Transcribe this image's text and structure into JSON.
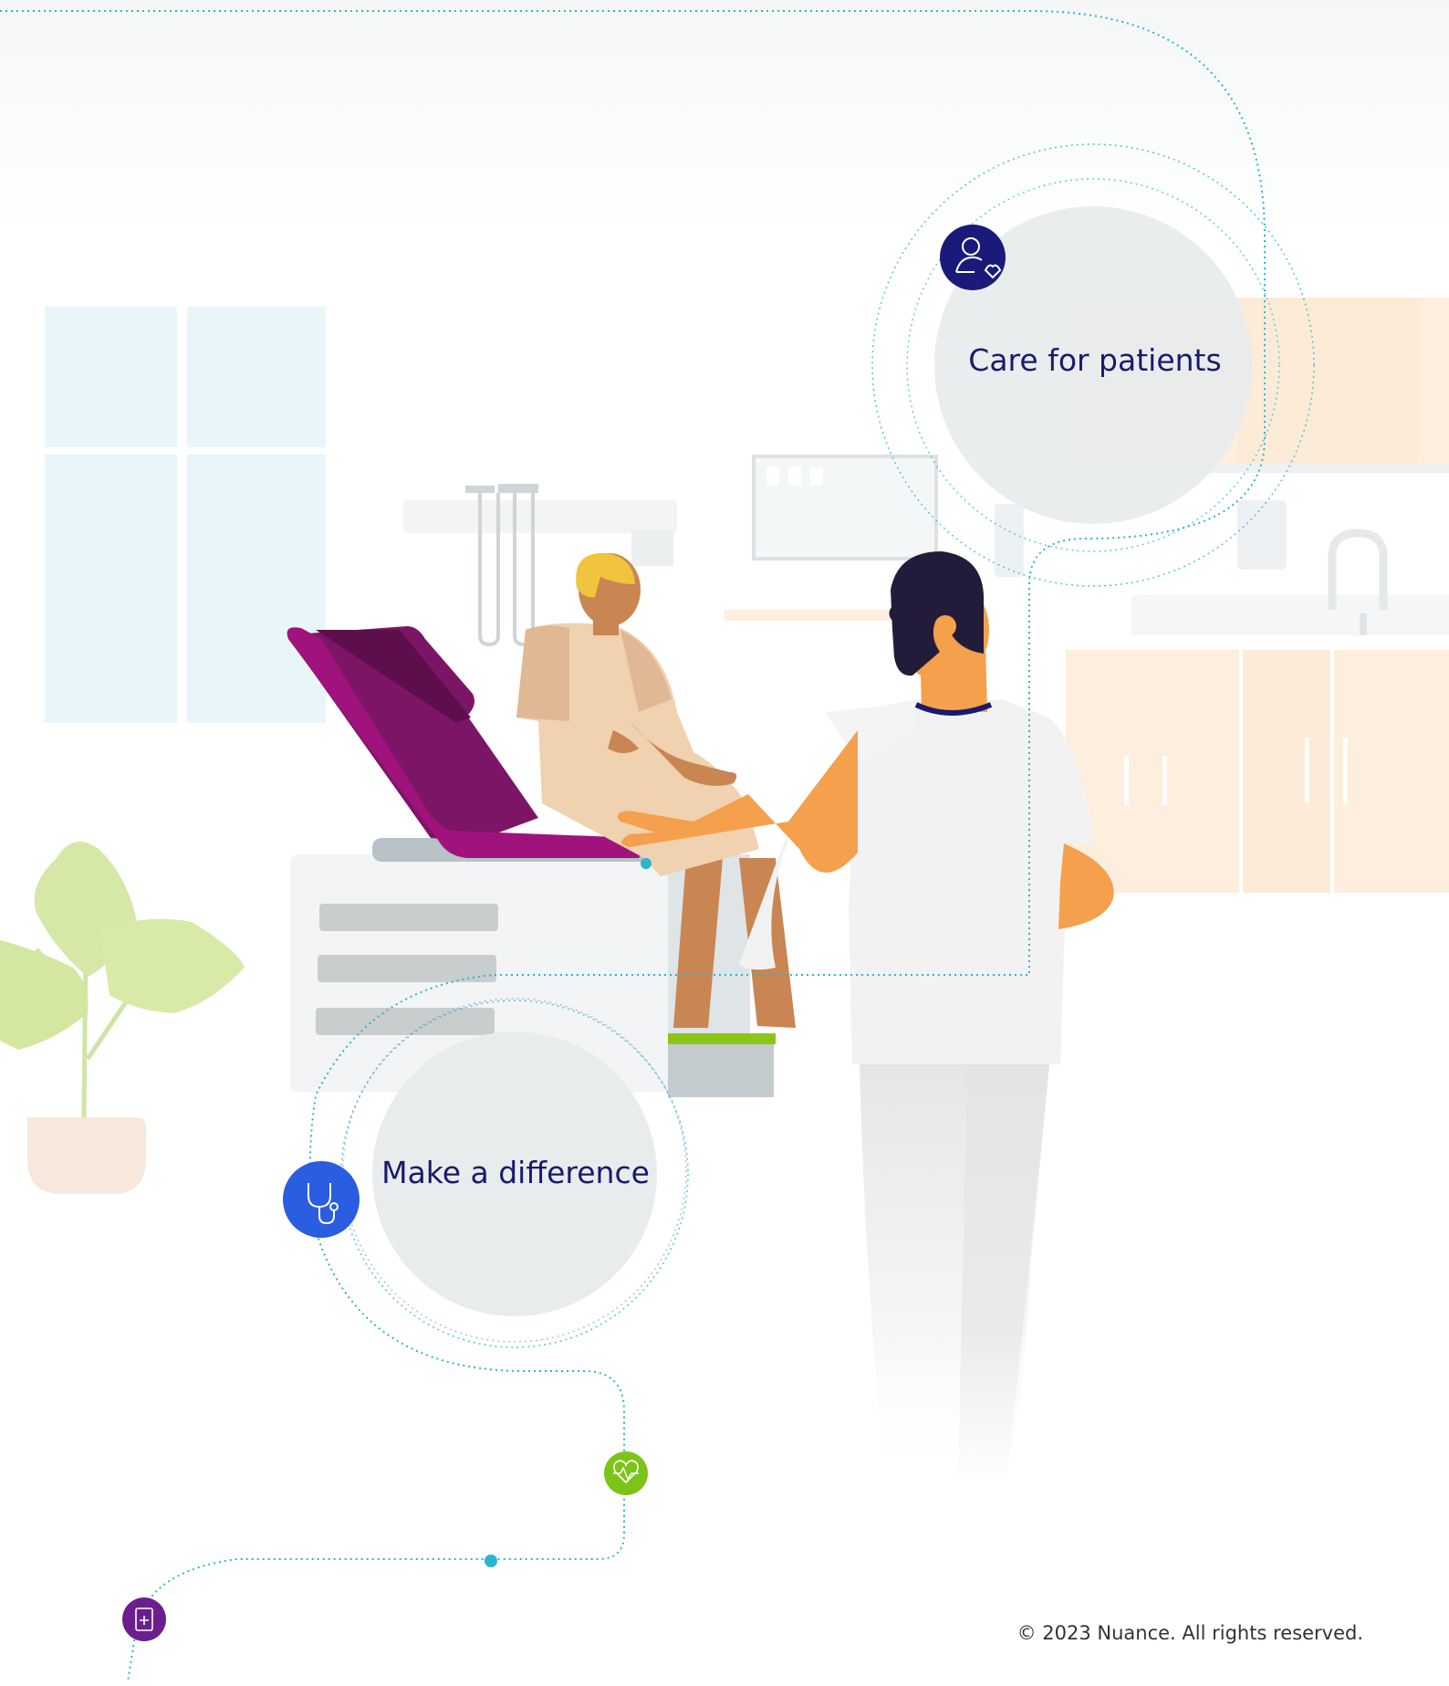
{
  "features": {
    "care": {
      "label": "Care for patients",
      "icon": "person-heart-icon"
    },
    "difference": {
      "label": "Make a difference",
      "icon": "stethoscope-icon"
    }
  },
  "markers": {
    "heart": {
      "icon": "heart-pulse-icon"
    },
    "record": {
      "icon": "medical-record-icon"
    }
  },
  "footer": {
    "copyright": "© 2023 Nuance. All rights reserved."
  },
  "colors": {
    "navy": "#1a1a7a",
    "blue": "#2a5de0",
    "green": "#7dc419",
    "purple": "#6b1f8f",
    "teal": "#2bb6cc",
    "magenta": "#a0127c",
    "skin": "#f5a04d"
  }
}
